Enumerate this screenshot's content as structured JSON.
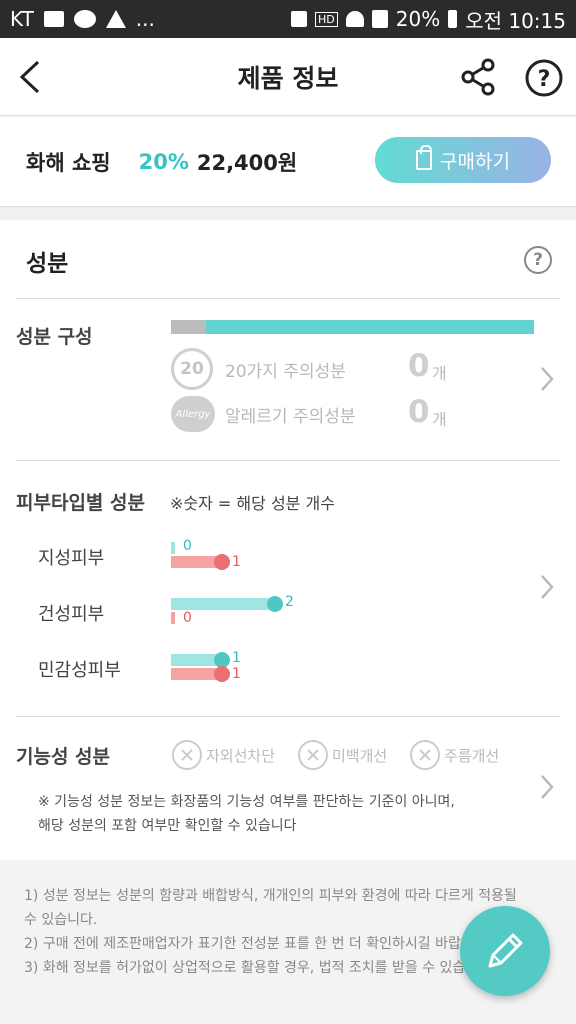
{
  "status_bar": {
    "carrier": "KT",
    "dots": "...",
    "battery": "20%",
    "time": "오전 10:15",
    "hd_label": "HD"
  },
  "header": {
    "title": "제품 정보"
  },
  "shop": {
    "name": "화해 쇼핑",
    "discount": "20%",
    "price": "22,400원",
    "buy_label": "구매하기"
  },
  "ingredients": {
    "title": "성분",
    "composition_label": "성분 구성",
    "badge_20": "20",
    "badge_allergy": "Allergy",
    "caution20_label": "20가지 주의성분",
    "caution20_count": "0",
    "allergy_label": "알레르기 주의성분",
    "allergy_count": "0",
    "count_unit": "개",
    "composition_caution_fraction": 0.096
  },
  "skin_type": {
    "title": "피부타입별 성분",
    "note": "※숫자 = 해당 성분 개수",
    "rows": [
      {
        "label": "지성피부",
        "good": 0,
        "bad": 1
      },
      {
        "label": "건성피부",
        "good": 2,
        "bad": 0
      },
      {
        "label": "민감성피부",
        "good": 1,
        "bad": 1
      }
    ]
  },
  "functional": {
    "title": "기능성 성분",
    "items": [
      "자외선차단",
      "미백개선",
      "주름개선"
    ],
    "note_line1": "※ 기능성 성분 정보는 화장품의 기능성 여부를 판단하는 기준이 아니며,",
    "note_line2": "해당 성분의 포함 여부만 확인할 수 있습니다"
  },
  "footer": {
    "line1": "1) 성분 정보는 성분의 함량과 배합방식, 개개인의 피부와 환경에 따라 다르게 적용될",
    "line1b": "수 있습니다.",
    "line2": "2) 구매 전에 제조판매업자가 표기한 전성분 표를 한 번 더 확인하시길 바랍니다.",
    "line3": "3) 화해 정보를 허가없이 상업적으로 활용할 경우, 법적 조치를 받을 수 있습니다."
  },
  "colors": {
    "accent": "#35c4c4",
    "good": "#4fc8c4",
    "bad": "#ec6f72"
  }
}
